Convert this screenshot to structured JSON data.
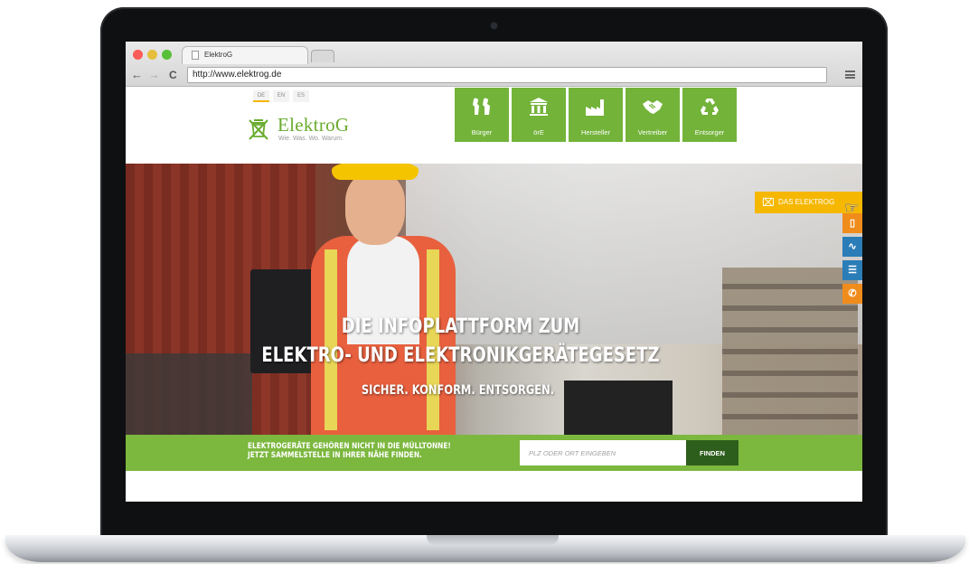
{
  "browser": {
    "tab_title": "ElektroG",
    "url": "http://www.elektrog.de",
    "back_icon": "back-arrow-icon",
    "forward_icon": "forward-arrow-icon",
    "reload_icon": "reload-icon",
    "menu_icon": "hamburger-menu-icon"
  },
  "site": {
    "languages": [
      "DE",
      "EN",
      "ES"
    ],
    "active_language": "DE",
    "logo": {
      "title": "ElektroG",
      "tagline": "Wie. Was. Wo. Warum."
    },
    "nav": [
      {
        "label": "Bürger",
        "icon": "people-icon"
      },
      {
        "label": "örE",
        "icon": "public-building-icon"
      },
      {
        "label": "Hersteller",
        "icon": "factory-icon"
      },
      {
        "label": "Vertreiber",
        "icon": "handshake-icon"
      },
      {
        "label": "Entsorger",
        "icon": "recycle-icon"
      }
    ],
    "hero": {
      "line1": "DIE INFOPLATTFORM ZUM",
      "line2": "ELEKTRO- UND ELEKTRONIKGERÄTEGESETZ",
      "line3": "SICHER. KONFORM. ENTSORGEN."
    },
    "side": {
      "tab_label": "DAS ELEKTROG",
      "icons": [
        "phone-device-icon",
        "rss-icon",
        "books-icon",
        "phone-icon"
      ],
      "icon_colors": [
        "#f08c1c",
        "#2a7db7",
        "#2a7db7",
        "#f08c1c"
      ]
    },
    "search": {
      "line1": "ELEKTROGERÄTE GEHÖREN NICHT IN DIE MÜLLTONNE!",
      "line2": "JETZT SAMMELSTELLE IN IHRER NÄHE FINDEN.",
      "placeholder": "PLZ ODER ORT EINGEBEN",
      "button": "FINDEN"
    }
  },
  "colors": {
    "brand_green": "#73b33a",
    "dark_green": "#2e5e1c",
    "accent_yellow": "#f5b700"
  }
}
